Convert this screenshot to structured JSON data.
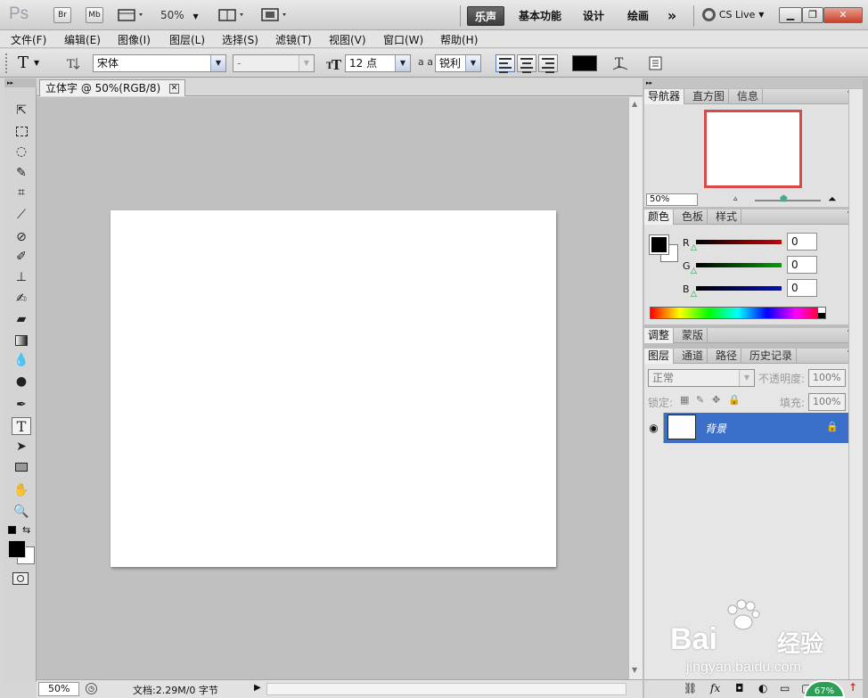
{
  "appbar": {
    "logo": "Ps",
    "bridge_label": "Br",
    "minibridge_label": "Mb",
    "zoom_value": "50%",
    "workspaces": [
      "乐声",
      "基本功能",
      "设计",
      "绘画"
    ],
    "overflow_label": "»",
    "cslive_label": "CS Live"
  },
  "menubar": {
    "items": [
      "文件(F)",
      "编辑(E)",
      "图像(I)",
      "图层(L)",
      "选择(S)",
      "滤镜(T)",
      "视图(V)",
      "窗口(W)",
      "帮助(H)"
    ]
  },
  "options": {
    "tool_glyph": "T",
    "font_family": "宋体",
    "font_style": "-",
    "font_size": "12 点",
    "aa_label": "a a",
    "aa_mode": "锐利",
    "text_color": "#000000"
  },
  "document": {
    "tab_title": "立体字 @ 50%(RGB/8)",
    "status_zoom": "50%",
    "status_info": "文档:2.29M/0 字节"
  },
  "navigator": {
    "tabs": [
      "导航器",
      "直方图",
      "信息"
    ],
    "zoom_value": "50%",
    "proxy_color": "#d84a4a"
  },
  "color_panel": {
    "tabs": [
      "颜色",
      "色板",
      "样式"
    ],
    "channels": [
      {
        "label": "R",
        "value": "0",
        "color": "#d00000"
      },
      {
        "label": "G",
        "value": "0",
        "color": "#00a000"
      },
      {
        "label": "B",
        "value": "0",
        "color": "#0010c0"
      }
    ]
  },
  "adjust_panel": {
    "tabs": [
      "调整",
      "蒙版"
    ]
  },
  "layers_panel": {
    "tabs": [
      "图层",
      "通道",
      "路径",
      "历史记录"
    ],
    "blend_mode": "正常",
    "opacity_label": "不透明度:",
    "opacity_value": "100%",
    "lock_label": "锁定:",
    "fill_label": "填充:",
    "fill_value": "100%",
    "layers": [
      {
        "name": "背景",
        "selected": true
      }
    ]
  },
  "watermark": {
    "brand": "Bai",
    "brand_cn": "经验",
    "url": "jingyan.baidu.com",
    "badge": "67%"
  }
}
